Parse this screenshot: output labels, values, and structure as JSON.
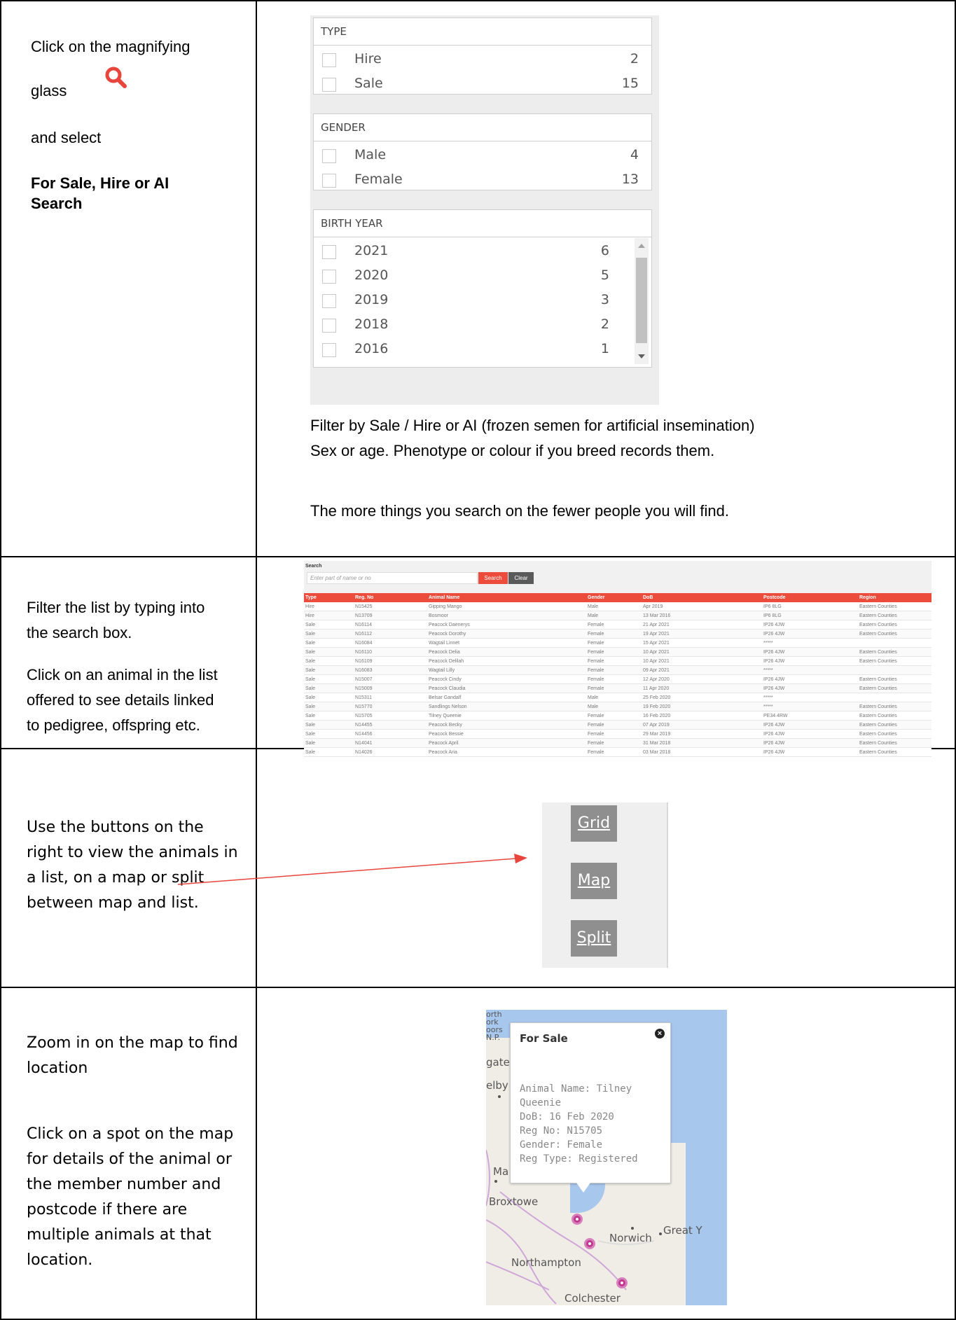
{
  "rows": [
    {
      "left_lines": [
        "Click on the magnifying",
        "glass",
        "and select"
      ],
      "left_bold": [
        "For Sale, Hire or AI",
        "Search"
      ],
      "right_lines": [
        "Filter by Sale / Hire or AI (frozen semen for artificial insemination)",
        "Sex or age. Phenotype or colour if you breed records them.",
        "The more things you search on the fewer people you will find."
      ]
    },
    {
      "left_lines": [
        "Filter the list by typing into",
        "the search box.",
        "Click on an animal in the list",
        "offered to see details linked",
        "to pedigree, offspring etc."
      ]
    },
    {
      "left_lines": [
        "Use the buttons on the",
        "right to view the animals in",
        "a list, on a map or split",
        "between map and list."
      ]
    },
    {
      "left_lines": [
        "Zoom in on the map to find",
        "location",
        "Click on a spot on the map",
        "for details of the animal or",
        "the member number and",
        "postcode if there are",
        "multiple animals at that",
        "location."
      ]
    }
  ],
  "magnifier_icon": "search-icon",
  "accent_color": "#e8453c",
  "filters": {
    "groups": [
      {
        "title": "TYPE",
        "items": [
          {
            "label": "Hire",
            "count": "2"
          },
          {
            "label": "Sale",
            "count": "15"
          }
        ]
      },
      {
        "title": "GENDER",
        "items": [
          {
            "label": "Male",
            "count": "4"
          },
          {
            "label": "Female",
            "count": "13"
          }
        ]
      },
      {
        "title": "BIRTH YEAR",
        "items": [
          {
            "label": "2021",
            "count": "6"
          },
          {
            "label": "2020",
            "count": "5"
          },
          {
            "label": "2019",
            "count": "3"
          },
          {
            "label": "2018",
            "count": "2"
          },
          {
            "label": "2016",
            "count": "1"
          }
        ]
      }
    ]
  },
  "search": {
    "label": "Search",
    "placeholder": "Enter part of name or no",
    "search_button": "Search",
    "clear_button": "Clear",
    "header_color": "#ec4c3c",
    "columns": [
      "Type",
      "Reg. No",
      "Animal Name",
      "Gender",
      "DoB",
      "Postcode",
      "Region"
    ],
    "rows": [
      [
        "Hire",
        "N15425",
        "Gipping Mango",
        "Male",
        "Apr 2019",
        "IP6 8LG",
        "Eastern Counties"
      ],
      [
        "Hire",
        "N13709",
        "Bosmoor",
        "Male",
        "13 Mar 2016",
        "IP6 8LG",
        "Eastern Counties"
      ],
      [
        "Sale",
        "N16114",
        "Peacock Daenerys",
        "Female",
        "21 Apr 2021",
        "IP26 4JW",
        "Eastern Counties"
      ],
      [
        "Sale",
        "N16112",
        "Peacock Dorothy",
        "Female",
        "19 Apr 2021",
        "IP26 4JW",
        "Eastern Counties"
      ],
      [
        "Sale",
        "N16084",
        "Wagtail Linnet",
        "Female",
        "15 Apr 2021",
        "*****",
        ""
      ],
      [
        "Sale",
        "N16110",
        "Peacock Delia",
        "Female",
        "10 Apr 2021",
        "IP26 4JW",
        "Eastern Counties"
      ],
      [
        "Sale",
        "N16109",
        "Peacock Delilah",
        "Female",
        "10 Apr 2021",
        "IP26 4JW",
        "Eastern Counties"
      ],
      [
        "Sale",
        "N16083",
        "Wagtail Lilly",
        "Female",
        "09 Apr 2021",
        "*****",
        ""
      ],
      [
        "Sale",
        "N15007",
        "Peacock Cindy",
        "Female",
        "12 Apr 2020",
        "IP26 4JW",
        "Eastern Counties"
      ],
      [
        "Sale",
        "N15009",
        "Peacock Claudia",
        "Female",
        "11 Apr 2020",
        "IP26 4JW",
        "Eastern Counties"
      ],
      [
        "Sale",
        "N15311",
        "Belsar Gandalf",
        "Male",
        "25 Feb 2020",
        "*****",
        ""
      ],
      [
        "Sale",
        "N15770",
        "Sandlings Nelson",
        "Male",
        "19 Feb 2020",
        "*****",
        "Eastern Counties"
      ],
      [
        "Sale",
        "N15705",
        "Tilney Queenie",
        "Female",
        "16 Feb 2020",
        "PE34 4RW",
        "Eastern Counties"
      ],
      [
        "Sale",
        "N14455",
        "Peacock Becky",
        "Female",
        "07 Apr 2019",
        "IP26 4JW",
        "Eastern Counties"
      ],
      [
        "Sale",
        "N14456",
        "Peacock Bessie",
        "Female",
        "29 Mar 2019",
        "IP26 4JW",
        "Eastern Counties"
      ],
      [
        "Sale",
        "N14041",
        "Peacock April",
        "Female",
        "31 Mar 2018",
        "IP26 4JW",
        "Eastern Counties"
      ],
      [
        "Sale",
        "N14026",
        "Peacock Aria",
        "Female",
        "03 Mar 2018",
        "IP26 4JW",
        "Eastern Counties"
      ]
    ]
  },
  "view_buttons": [
    "Grid",
    "Map",
    "Split"
  ],
  "map": {
    "popup_title": "For Sale",
    "popup_lines": [
      "Animal Name: Tilney",
      "Queenie",
      "DoB: 16 Feb 2020",
      "Reg No: N15705",
      "Gender: Female",
      "Reg Type: Registered"
    ],
    "places": [
      "orth",
      "ork",
      "oors",
      "N.P.",
      "gate",
      "elby",
      "Ma",
      "Broxtowe",
      "Norwich",
      "Great Y",
      "Northampton",
      "Colchester"
    ],
    "pin_color": "#c0398e"
  }
}
